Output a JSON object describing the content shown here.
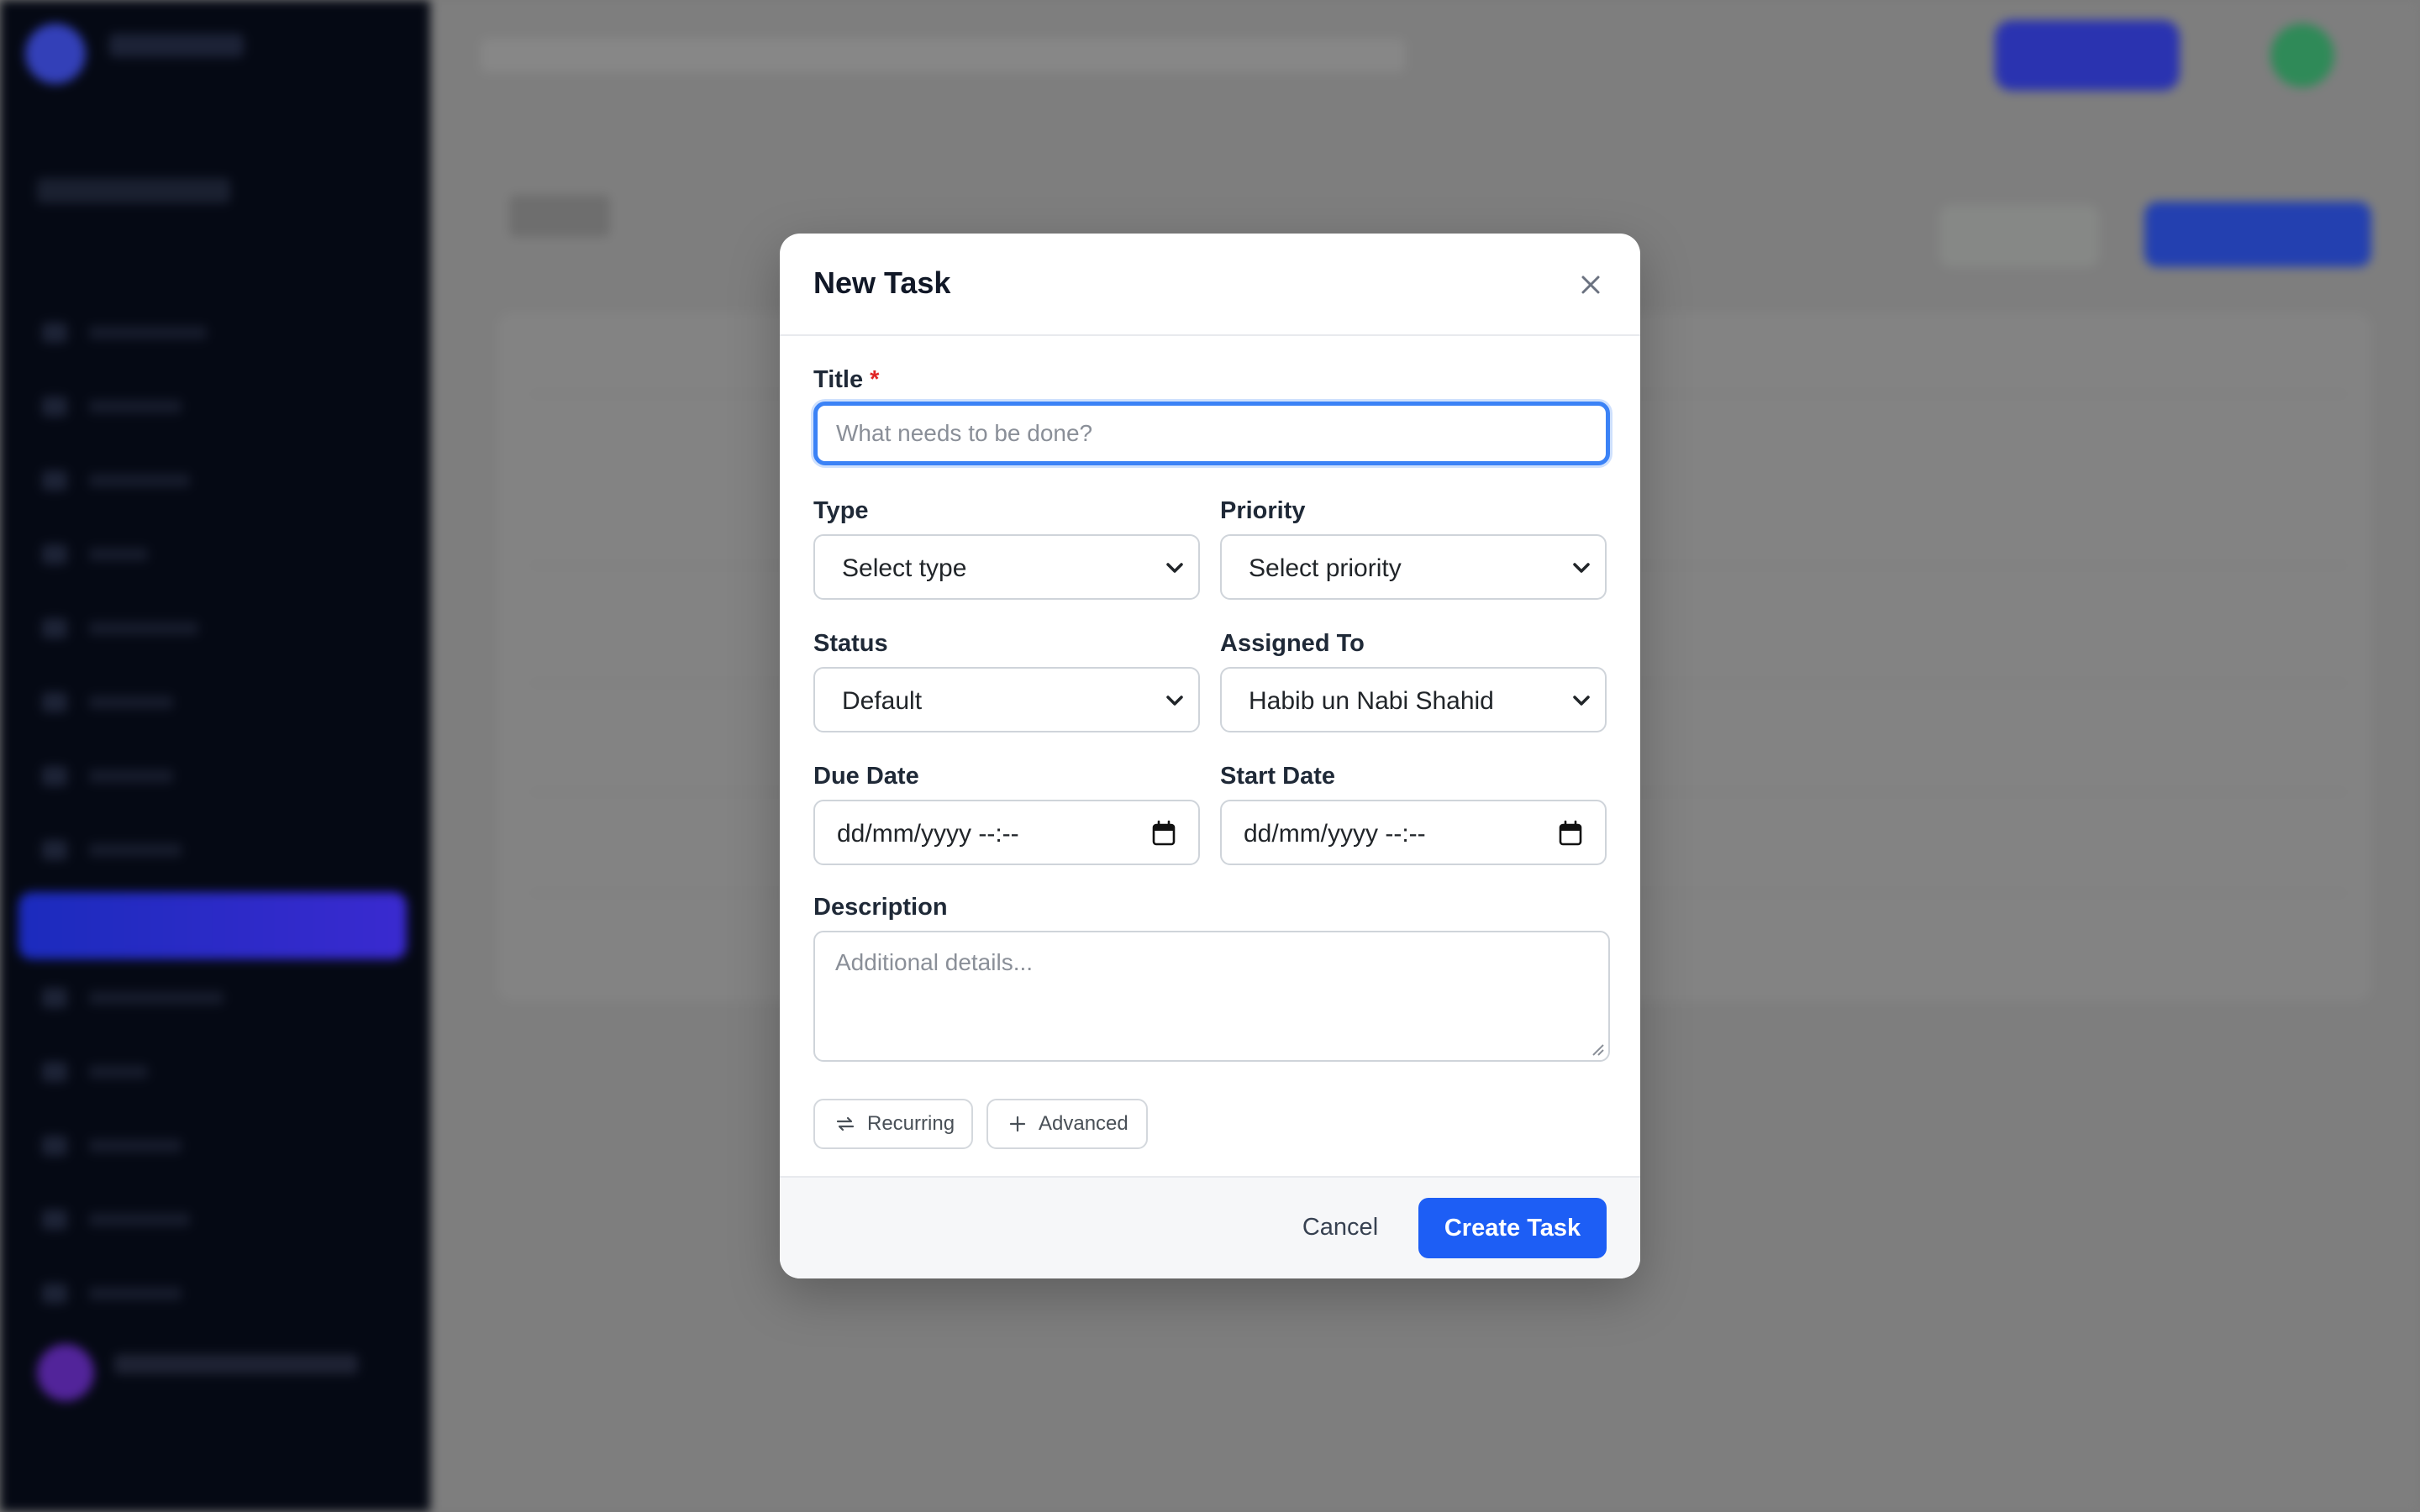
{
  "modal": {
    "title": "New Task",
    "fields": {
      "title": {
        "label": "Title",
        "required_mark": "*",
        "placeholder": "What needs to be done?",
        "value": ""
      },
      "type": {
        "label": "Type",
        "value": "Select type"
      },
      "priority": {
        "label": "Priority",
        "value": "Select priority"
      },
      "status": {
        "label": "Status",
        "value": "Default"
      },
      "assigned_to": {
        "label": "Assigned To",
        "value": "Habib un Nabi Shahid"
      },
      "due_date": {
        "label": "Due Date",
        "value": "dd/mm/yyyy --:--"
      },
      "start_date": {
        "label": "Start Date",
        "value": "dd/mm/yyyy --:--"
      },
      "description": {
        "label": "Description",
        "placeholder": "Additional details..."
      }
    },
    "options": {
      "recurring": "Recurring",
      "advanced": "Advanced"
    },
    "footer": {
      "cancel": "Cancel",
      "create": "Create Task"
    }
  },
  "colors": {
    "primary": "#1d5ef5",
    "focus_ring": "#3b82f6",
    "sidebar": "#050914",
    "overlay": "#7e7e7e",
    "required": "#e02424"
  },
  "icons": [
    "close-icon",
    "chevron-down-icon",
    "calendar-icon",
    "repeat-icon",
    "plus-icon"
  ]
}
